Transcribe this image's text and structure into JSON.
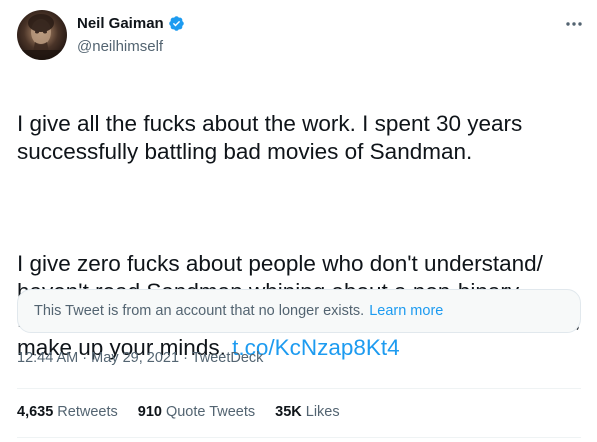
{
  "author": {
    "display_name": "Neil Gaiman",
    "handle": "@neilhimself",
    "verified": true
  },
  "tweet": {
    "paragraph1": "I give all the fucks about the work. I spent 30 years successfully battling bad movies of Sandman.",
    "paragraph2": "I give zero fucks about people who don't understand/ haven't read Sandman whining about a non-binary Desire or that Death isn't white enough. Watch the show, make up your minds. ",
    "link_text": "t.co/KcNzap8Kt4"
  },
  "quoted_notice": {
    "text": "This Tweet is from an account that no longer exists.",
    "link": "Learn more"
  },
  "meta": {
    "time": "12:44 AM",
    "separator": "·",
    "date": "May 29, 2021",
    "source": "TweetDeck"
  },
  "stats": {
    "retweets_count": "4,635",
    "retweets_label": "Retweets",
    "quotes_count": "910",
    "quotes_label": "Quote Tweets",
    "likes_count": "35K",
    "likes_label": "Likes"
  },
  "icons": {
    "verified": "verified-badge-icon",
    "more": "more-options-icon"
  },
  "colors": {
    "accent": "#1d9bf0",
    "text": "#0f1419",
    "secondary": "#536471",
    "notice_bg": "#f7f9f9",
    "border": "#e1e8ed"
  }
}
